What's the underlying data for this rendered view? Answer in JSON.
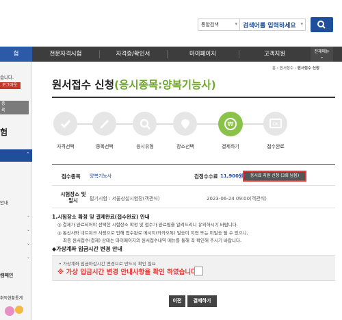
{
  "search": {
    "scope": "통합검색",
    "placeholder": "검색어를 입력하세요"
  },
  "nav": {
    "items": [
      "험",
      "전문자격시험",
      "자격증/확인서",
      "마이페이지",
      "고객지원"
    ],
    "all_menu": "전체메뉴"
  },
  "sidebar": {
    "greeting": "습니다.",
    "logout": "로그아웃",
    "btn1": "증",
    "btn2": "록",
    "section_title": "험",
    "item_text": "안내",
    "campaign": "캠페인",
    "stats": "취득현황통계"
  },
  "breadcrumb": [
    "홈",
    "원서접수",
    "원서접수 신청"
  ],
  "page": {
    "title_prefix": "원서접수 신청",
    "title_highlight": "(응시종목:양복기능사)"
  },
  "steps": [
    "자격선택",
    "종목선택",
    "응시유형",
    "장소선택",
    "결제하기",
    "접수완료"
  ],
  "info": {
    "subject_label": "접수종목",
    "subject_value": "양복기능사",
    "fee_label": "검정수수료",
    "fee_value": "11,900원",
    "fee_button": "응시료 지원 신청 (3회 남음)",
    "venue_label": "시험장소 및 일시",
    "venue_value": "필기시험 : 서울상설시험장(객관식)",
    "venue_time": "2023-06-24 09:00(객관식)"
  },
  "notice1": {
    "heading": "1.시험장소 확정 및 결제완료(접수완료) 안내",
    "lines": [
      "◎ 결제가 완료되어야 선택한 시험장소 확정 및 접수가 완료됨을 알려드리니 유의하시기 바랍니다.",
      "◎ 통신사와 네트워크 사정으로 인해 접수완료 메시지(카카오톡) 발송이 지연 또는 미발송 될 수 있으니,",
      "최종 원서접수(결제) 상태는 마이페이지의 원서접수내역 메뉴를 통해 꼭 확인해 주시기 바랍니다."
    ]
  },
  "notice2": {
    "heading": "◆가상계좌 입금시간 변경 안내",
    "small": "• 가상계좌 입금마감시간 변경으로 반드시 확인 필요",
    "warning": "※ 가상 입금시간 변경 안내사항을 확인 하였습니다."
  },
  "buttons": {
    "prev": "이전",
    "pay": "결제하기"
  }
}
